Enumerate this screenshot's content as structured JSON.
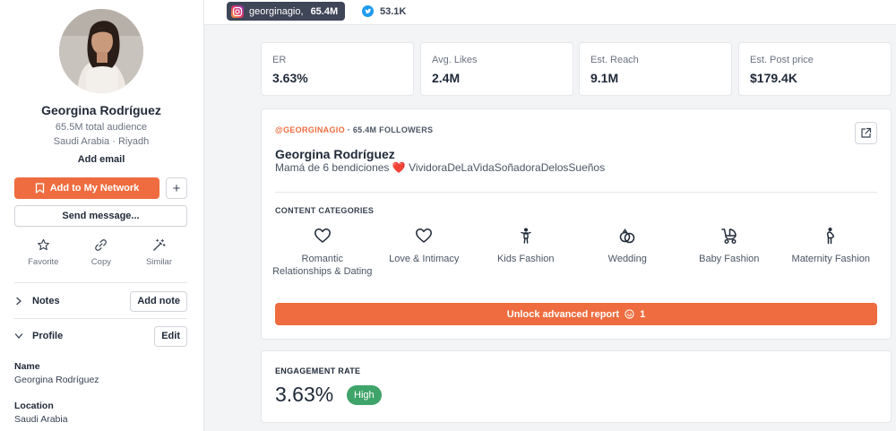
{
  "platforms": {
    "instagram": {
      "handle": "georginagio,",
      "count": "65.4M"
    },
    "twitter": {
      "count": "53.1K"
    }
  },
  "sidebar": {
    "name": "Georgina Rodríguez",
    "audience": "65.5M total audience",
    "location": "Saudi Arabia · Riyadh",
    "add_email": "Add email",
    "add_network_label": "Add to My Network",
    "plus_label": "+",
    "send_message_label": "Send message...",
    "actions": [
      {
        "label": "Favorite",
        "icon": "star-icon"
      },
      {
        "label": "Copy",
        "icon": "link-icon"
      },
      {
        "label": "Similar",
        "icon": "magic-wand-icon"
      }
    ],
    "notes": {
      "title": "Notes",
      "button": "Add note"
    },
    "profile": {
      "title": "Profile",
      "button": "Edit"
    },
    "fields": [
      {
        "label": "Name",
        "value": "Georgina Rodríguez"
      },
      {
        "label": "Location",
        "value": "Saudi Arabia"
      }
    ]
  },
  "stats": [
    {
      "label": "ER",
      "value": "3.63%"
    },
    {
      "label": "Avg. Likes",
      "value": "2.4M"
    },
    {
      "label": "Est. Reach",
      "value": "9.1M"
    },
    {
      "label": "Est. Post price",
      "value": "$179.4K"
    }
  ],
  "profile_card": {
    "handle": "@GEORGINAGIO",
    "separator": "·",
    "followers": "65.4M FOLLOWERS",
    "name": "Georgina Rodríguez",
    "bio_before": "Mamá de 6 bendiciones",
    "bio_heart": "❤️",
    "bio_after": "VividoraDeLaVidaSoñadoraDelosSueños",
    "categories_title": "CONTENT CATEGORIES",
    "categories": [
      {
        "label": "Romantic Relationships & Dating",
        "icon": "heart-icon"
      },
      {
        "label": "Love & Intimacy",
        "icon": "heart-icon"
      },
      {
        "label": "Kids Fashion",
        "icon": "child-icon"
      },
      {
        "label": "Wedding",
        "icon": "rings-icon"
      },
      {
        "label": "Baby Fashion",
        "icon": "stroller-icon"
      },
      {
        "label": "Maternity Fashion",
        "icon": "pregnant-icon"
      }
    ],
    "unlock_label": "Unlock advanced report",
    "unlock_cost": "1"
  },
  "engagement": {
    "title": "ENGAGEMENT RATE",
    "value": "3.63%",
    "badge": "High"
  },
  "colors": {
    "accent": "#ee6c3f",
    "chip_dark": "#3f4658",
    "success": "#3fa46a",
    "twitter": "#1d9bf0"
  }
}
